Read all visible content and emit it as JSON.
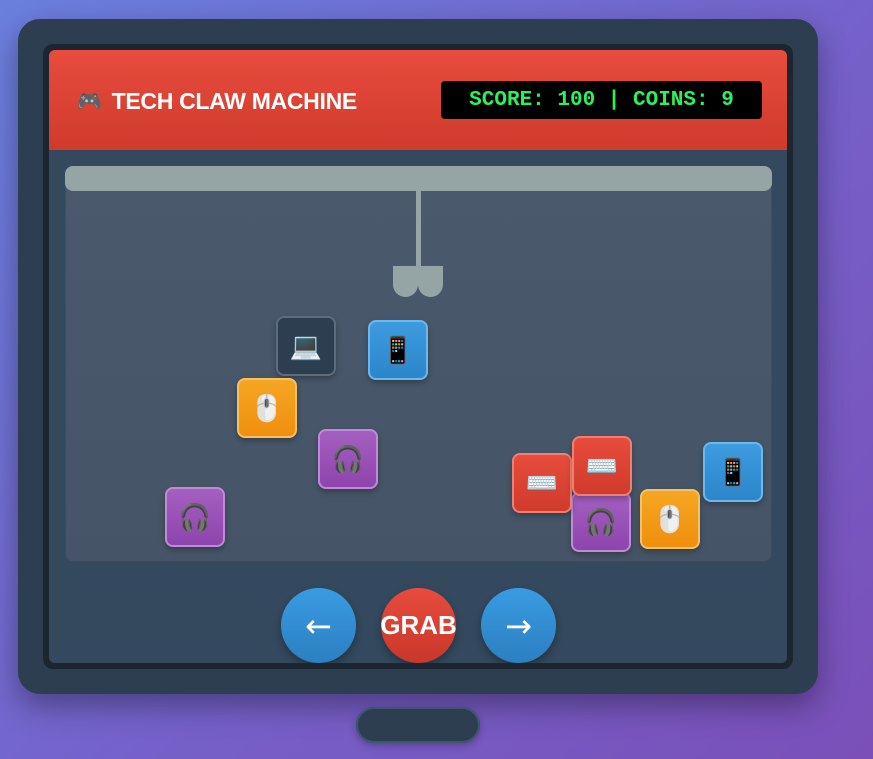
{
  "header": {
    "icon": "🎮",
    "icon_name": "game-controller-icon",
    "title": "TECH CLAW MACHINE",
    "score_display": "SCORE: 100 | COINS: 9"
  },
  "game": {
    "score": 100,
    "coins": 9
  },
  "prizes": [
    {
      "glyph": "💻",
      "name": "laptop-icon",
      "color": "dark"
    },
    {
      "glyph": "📱",
      "name": "tablet-icon",
      "color": "blue"
    },
    {
      "glyph": "🖱️",
      "name": "mouse-icon",
      "color": "orange"
    },
    {
      "glyph": "🎧",
      "name": "headphones-icon",
      "color": "purple"
    },
    {
      "glyph": "🎧",
      "name": "headphones-icon",
      "color": "purple"
    },
    {
      "glyph": "⌨️",
      "name": "keyboard-icon",
      "color": "red"
    },
    {
      "glyph": "⌨️",
      "name": "keyboard-icon",
      "color": "red"
    },
    {
      "glyph": "🎧",
      "name": "headphones-icon",
      "color": "purple"
    },
    {
      "glyph": "🖱️",
      "name": "mouse-icon",
      "color": "orange"
    },
    {
      "glyph": "📱",
      "name": "tablet-icon",
      "color": "blue"
    }
  ],
  "controls": {
    "left_label": "←",
    "grab_label": "GRAB",
    "right_label": "→"
  },
  "colors": {
    "header_red": "#e84c3d",
    "score_green": "#2ff05a",
    "cabinet": "#2c3e50",
    "rail": "#95a5a6",
    "button_blue": "#3498db"
  }
}
